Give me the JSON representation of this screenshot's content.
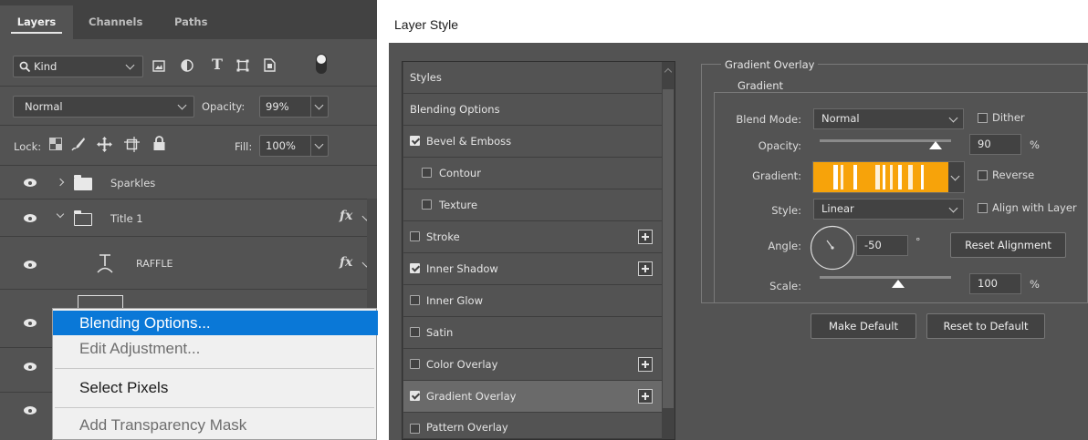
{
  "layers_panel": {
    "tabs": [
      "Layers",
      "Channels",
      "Paths"
    ],
    "filter": {
      "kind_label": "Kind"
    },
    "blend_mode": "Normal",
    "opacity_label": "Opacity:",
    "opacity_value": "99%",
    "lock_label": "Lock:",
    "fill_label": "Fill:",
    "fill_value": "100%",
    "layers": [
      {
        "name": "Sparkles",
        "type": "group",
        "expanded": false
      },
      {
        "name": "Title 1",
        "type": "group",
        "expanded": true,
        "fx": "fx"
      },
      {
        "name": "RAFFLE",
        "type": "warped-text",
        "fx": "fx"
      }
    ],
    "context_menu": {
      "items": [
        {
          "label": "Blending Options...",
          "highlighted": true
        },
        {
          "label": "Edit Adjustment...",
          "disabled": true
        },
        {
          "label": "Select Pixels"
        },
        {
          "label": "Add Transparency Mask",
          "disabled": true
        }
      ]
    }
  },
  "layer_style": {
    "title": "Layer Style",
    "styles_list": [
      {
        "label": "Styles",
        "checkbox": false
      },
      {
        "label": "Blending Options",
        "checkbox": false
      },
      {
        "label": "Bevel & Emboss",
        "checkbox": true,
        "checked": true
      },
      {
        "label": "Contour",
        "checkbox": true,
        "checked": false,
        "indent": true
      },
      {
        "label": "Texture",
        "checkbox": true,
        "checked": false,
        "indent": true
      },
      {
        "label": "Stroke",
        "checkbox": true,
        "checked": false,
        "plus": true
      },
      {
        "label": "Inner Shadow",
        "checkbox": true,
        "checked": true,
        "plus": true
      },
      {
        "label": "Inner Glow",
        "checkbox": true,
        "checked": false
      },
      {
        "label": "Satin",
        "checkbox": true,
        "checked": false
      },
      {
        "label": "Color Overlay",
        "checkbox": true,
        "checked": false,
        "plus": true
      },
      {
        "label": "Gradient Overlay",
        "checkbox": true,
        "checked": true,
        "plus": true,
        "selected": true
      },
      {
        "label": "Pattern Overlay",
        "checkbox": true,
        "checked": false
      }
    ],
    "gradient_overlay": {
      "section_title": "Gradient Overlay",
      "subsection_title": "Gradient",
      "blend_mode_label": "Blend Mode:",
      "blend_mode_value": "Normal",
      "dither_label": "Dither",
      "dither_checked": false,
      "opacity_label": "Opacity:",
      "opacity_value": "90",
      "opacity_fraction": 0.9,
      "percent_sign": "%",
      "gradient_label": "Gradient:",
      "reverse_label": "Reverse",
      "reverse_checked": false,
      "style_label": "Style:",
      "style_value": "Linear",
      "align_label": "Align with Layer",
      "align_checked": false,
      "angle_label": "Angle:",
      "angle_value": "-50",
      "degree_sign": "°",
      "reset_alignment_label": "Reset Alignment",
      "scale_label": "Scale:",
      "scale_value": "100",
      "make_default_label": "Make Default",
      "reset_default_label": "Reset to Default"
    },
    "colors": {
      "gradient_main": "#f7a30a",
      "gradient_stripe": "#ffffff"
    }
  }
}
